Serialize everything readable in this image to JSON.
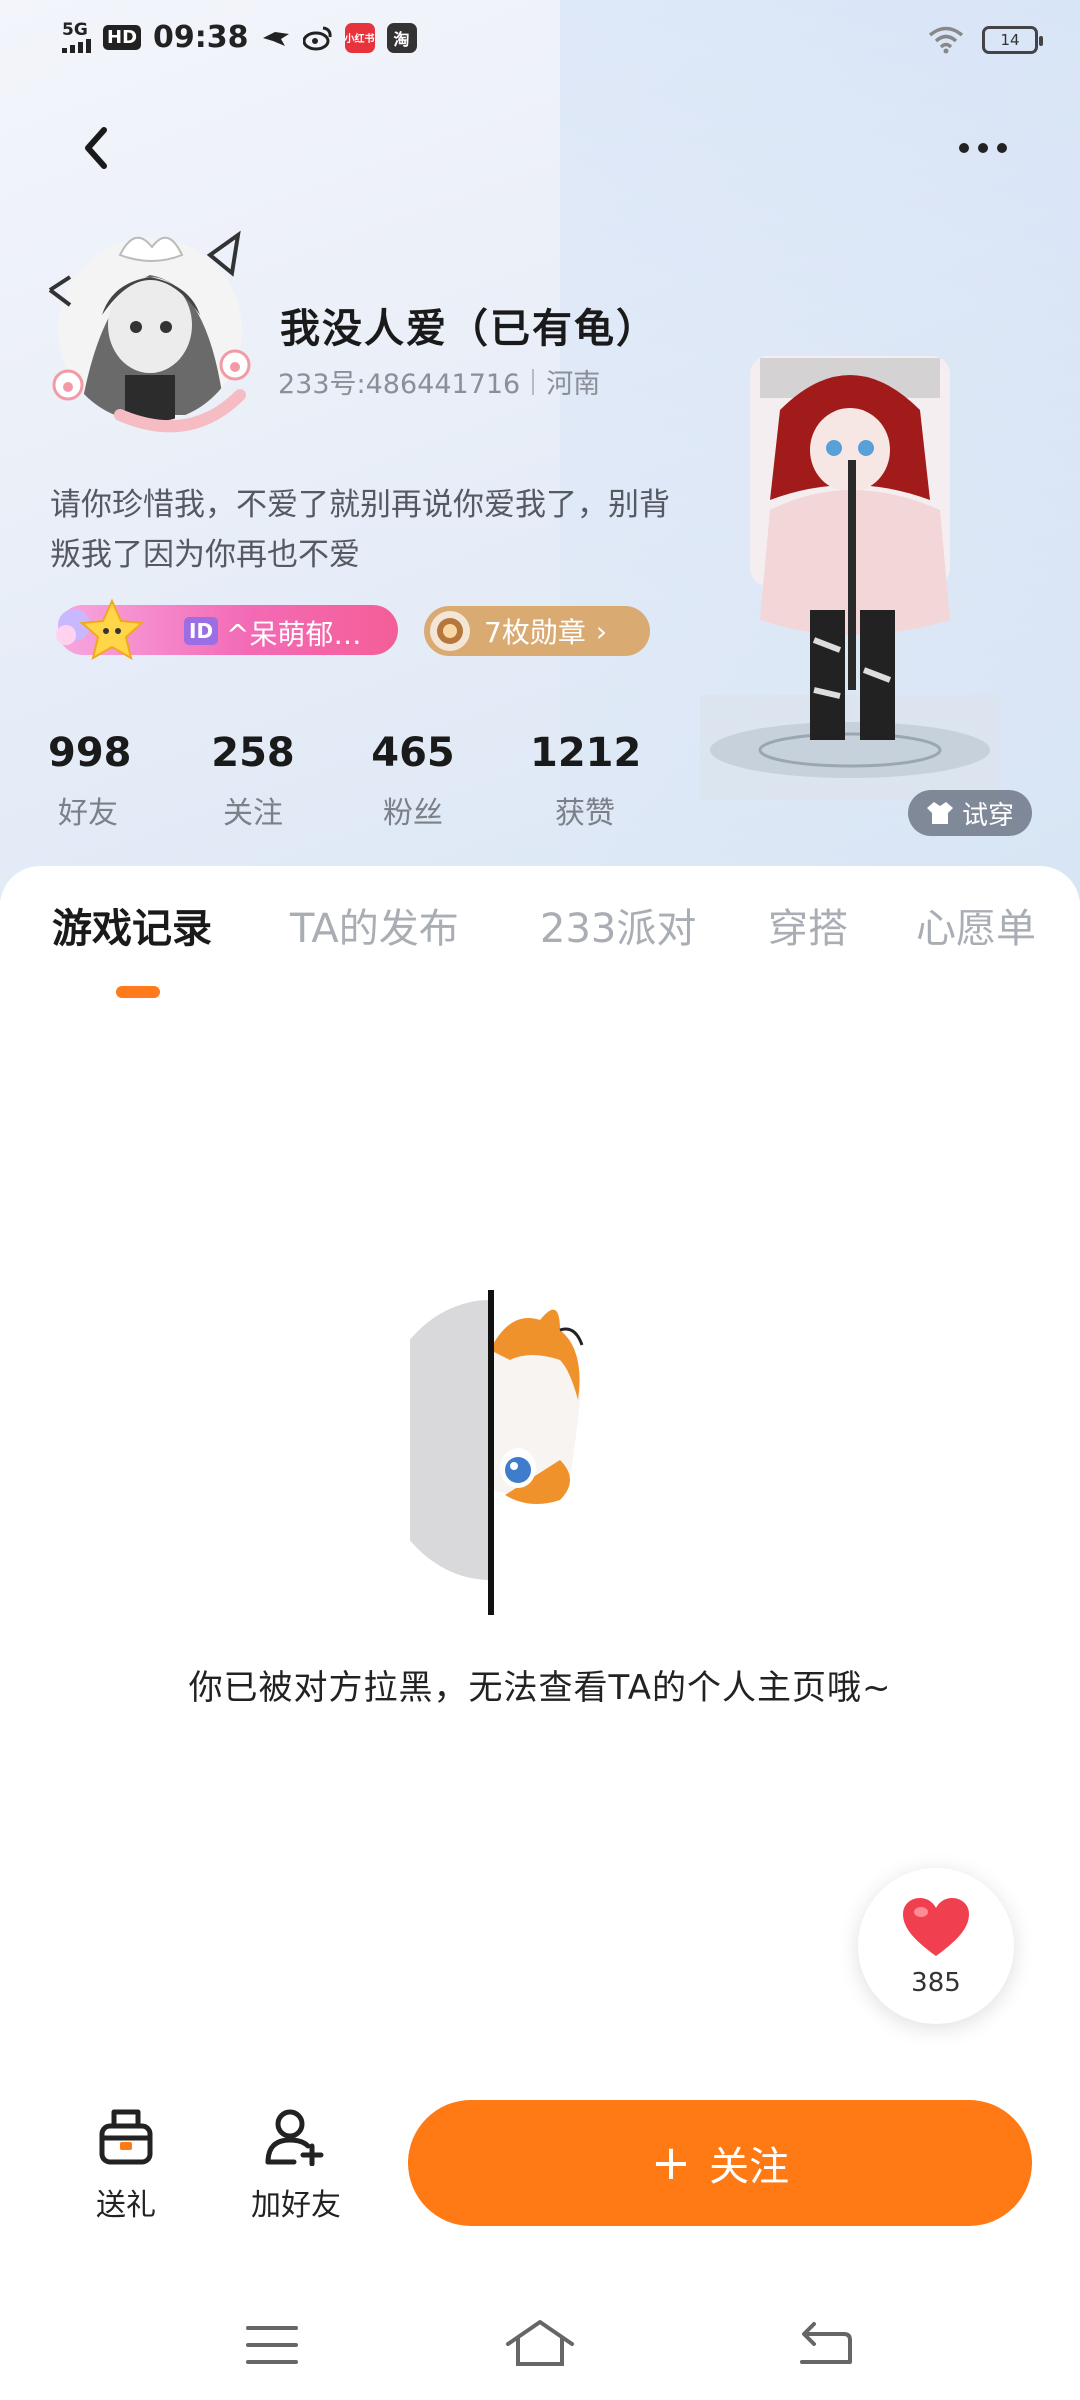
{
  "status_bar": {
    "network": "5G",
    "hd": "HD",
    "time": "09:38",
    "app_icon_1": "小红书",
    "app_icon_2": "淘",
    "battery": "14"
  },
  "profile": {
    "username": "我没人爱（已有龟）",
    "user_id": "233号:486441716",
    "location": "河南",
    "bio": "请你珍惜我，不爱了就别再说你爱我了，别背叛我了因为你再也不爱",
    "badge_id_tag": "ID",
    "badge_text": "^呆萌郁…",
    "medals": "7枚勋章",
    "tryon_label": "试穿"
  },
  "stats": [
    {
      "value": "998",
      "label": "好友"
    },
    {
      "value": "258",
      "label": "关注"
    },
    {
      "value": "465",
      "label": "粉丝"
    },
    {
      "value": "1212",
      "label": "获赞"
    }
  ],
  "tabs": [
    {
      "label": "游戏记录",
      "active": true
    },
    {
      "label": "TA的发布",
      "active": false
    },
    {
      "label": "233派对",
      "active": false
    },
    {
      "label": "穿搭",
      "active": false
    },
    {
      "label": "心愿单",
      "active": false
    }
  ],
  "empty_state": {
    "message": "你已被对方拉黑，无法查看TA的个人主页哦~"
  },
  "like": {
    "count": "385",
    "color": "#f0404f"
  },
  "bottom_bar": {
    "gift_label": "送礼",
    "add_friend_label": "加好友",
    "follow_label": "关注",
    "follow_icon": "+"
  },
  "colors": {
    "accent": "#ff7a14",
    "badge_pink": "#f36bb6",
    "medal_gold": "#d9ab72"
  }
}
